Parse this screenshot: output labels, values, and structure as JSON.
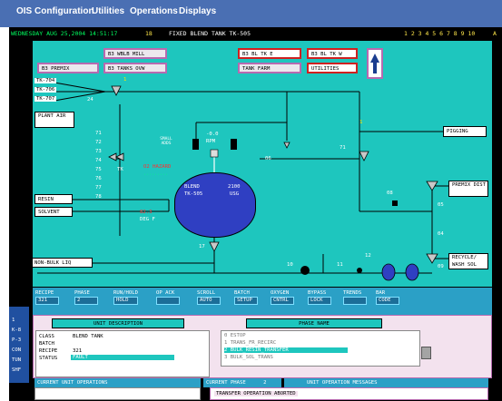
{
  "menu": {
    "items": [
      "OIS Configuration",
      "Utilities",
      "Operations",
      "Displays"
    ]
  },
  "status_bar": {
    "date": "WEDNESDAY AUG 25,2004 14:51:17",
    "station": "18",
    "screen_title": "FIXED BLEND TANK TK-505",
    "tabs": "1 2 3 4 5 6 7 8 9 10",
    "tab_right": "A"
  },
  "nav_buttons": {
    "b3_wblb_mill": "B3 WBLB MILL",
    "b3_tanks_ovw": "B3 TANKS OVW",
    "b3_premix": "B3 PREMIX",
    "b3_bl_tk_e": "B3 BL TK E",
    "b3_bl_tk_w": "B3 BL TK W",
    "tank_farm": "TANK FARM",
    "utilities": "UTILITIES"
  },
  "sources": {
    "tk704": "TK-704",
    "tk706": "TK-706",
    "tk707": "TK-707",
    "plant_air": "PLANT AIR",
    "resin": "RESIN",
    "solvent": "SOLVENT",
    "non_bulk_liq": "NON-BULK LIQ"
  },
  "destinations": {
    "pigging": "PIGGING",
    "premix_dist": "PREMIX DIST",
    "recycle": "RECYCLE/ WASH SOL"
  },
  "valve_labels": {
    "v24": "24",
    "v1_top": "1",
    "v1_right": "1",
    "v71": "71",
    "v06": "06",
    "v08": "08",
    "v05": "05",
    "v04": "04",
    "v09": "09",
    "v17": "17",
    "v10": "10",
    "v11": "11",
    "v12": "12",
    "tk": "TK"
  },
  "process": {
    "addresses": [
      "71",
      "72",
      "73",
      "74",
      "75",
      "76",
      "77",
      "78"
    ],
    "small_adds": "SMALL ADDS",
    "o2_hazard": "O2 HAZARD",
    "agitator_reading": "-0.0",
    "agitator_unit": "RPM",
    "tank_name": "BLEND",
    "tank_id": "TK-505",
    "tank_level": "2100",
    "tank_level_unit": "USG",
    "temperature": "82.3",
    "temperature_unit": "DEG F"
  },
  "controls": [
    {
      "label": "RECIPE",
      "value": "321"
    },
    {
      "label": "PHASE",
      "value": "2"
    },
    {
      "label": "RUN/HOLD",
      "value": "HOLD"
    },
    {
      "label": "OP ACK",
      "value": ""
    },
    {
      "label": "SCROLL",
      "value": "AUTO"
    },
    {
      "label": "BATCH",
      "value": "SETUP"
    },
    {
      "label": "OXYGEN",
      "value": "CNTRL"
    },
    {
      "label": "BYPASS",
      "value": "LOCK"
    },
    {
      "label": "TRENDS",
      "value": ""
    },
    {
      "label": "BAR",
      "value": "CODE"
    }
  ],
  "unit_description": {
    "header": "UNIT DESCRIPTION",
    "class_label": "CLASS",
    "class_value": "BLEND TANK",
    "batch_label": "BATCH",
    "batch_value": "",
    "recipe_label": "RECIPE",
    "recipe_value": "321",
    "status_label": "STATUS",
    "status_value": "FAULT"
  },
  "phase_name": {
    "header": "PHASE NAME",
    "phases": [
      "0 ESTOP",
      "1 TRANS_FR_RECIRC",
      "2 BULK_RESIN_TRANSFER",
      "3 BULK_SOL_TRANS"
    ],
    "selected_index": 2
  },
  "bottom": {
    "current_unit_ops": "CURRENT UNIT OPERATIONS",
    "current_phase_label": "CURRENT PHASE",
    "current_phase_value": "2",
    "unit_op_messages": "UNIT OPERATION MESSAGES",
    "message": "TRANSFER OPERATION ABORTED"
  },
  "left_panel": [
    "1",
    "K-8",
    "P-3",
    "CON",
    "TUN",
    "SHF"
  ],
  "colors": {
    "menubar": "#4a6fb3",
    "mimic_bg": "#1ec6be",
    "tank": "#2f3fc2",
    "controls_bar": "#2ba0c6",
    "status_text": "#ffe74a"
  }
}
